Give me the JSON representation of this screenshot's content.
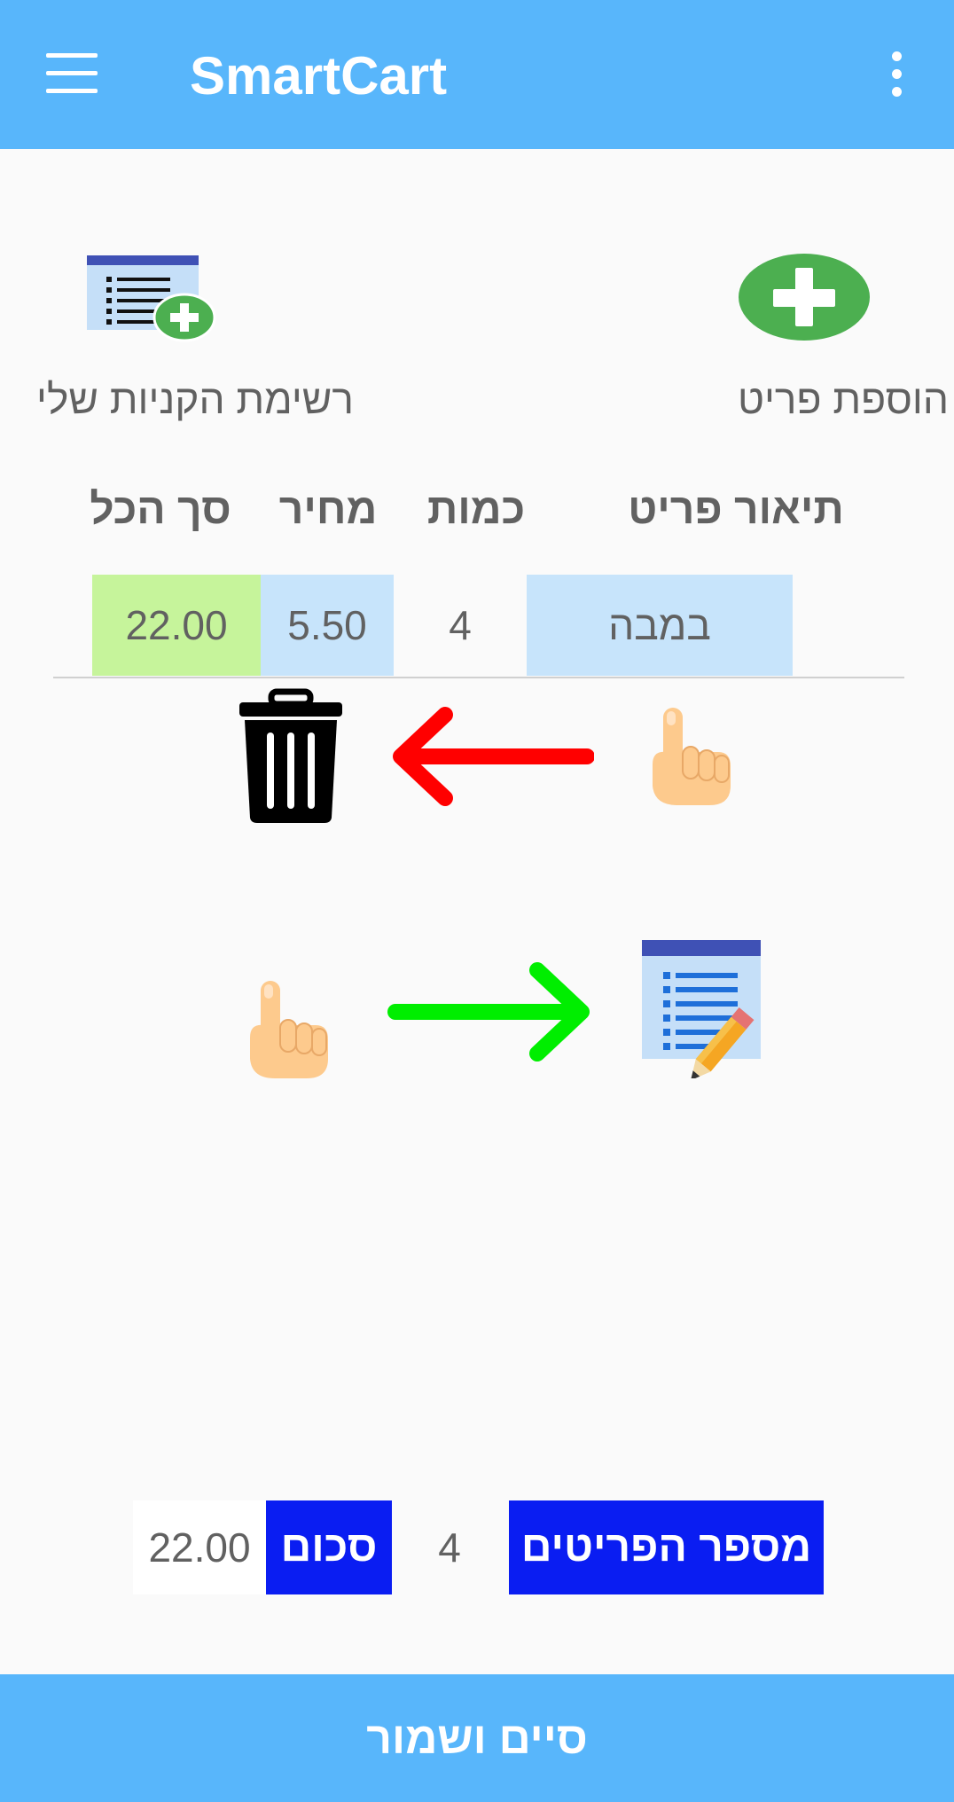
{
  "app_bar": {
    "title": "SmartCart",
    "menu_icon": "hamburger-menu-icon",
    "overflow_icon": "more-vert-icon",
    "color": "#58b6fb"
  },
  "actions": {
    "add_item": {
      "label": "הוספת פריט",
      "icon": "add-circle-icon",
      "color": "#4caf50"
    },
    "my_list": {
      "label": "רשימת הקניות שלי",
      "icon": "list-add-icon"
    }
  },
  "table": {
    "headers": {
      "description": "תיאור פריט",
      "quantity": "כמות",
      "price": "מחיר",
      "total": "סך הכל"
    },
    "rows": [
      {
        "description": "במבה",
        "quantity": "4",
        "price": "5.50",
        "total": "22.00"
      }
    ]
  },
  "hints": {
    "delete": {
      "gesture_icon": "pointing-hand-icon",
      "arrow_icon": "arrow-left-icon",
      "arrow_color": "#ff0000",
      "target_icon": "trash-icon"
    },
    "edit": {
      "gesture_icon": "pointing-hand-icon",
      "arrow_icon": "arrow-right-icon",
      "arrow_color": "#00ee00",
      "target_icon": "edit-list-icon"
    }
  },
  "summary": {
    "items_count_label": "מספר הפריטים",
    "items_count_value": "4",
    "sum_label": "סכום",
    "sum_value": "22.00",
    "label_color": "#0a1df2"
  },
  "footer": {
    "finish_save_label": "סיים ושמור"
  }
}
